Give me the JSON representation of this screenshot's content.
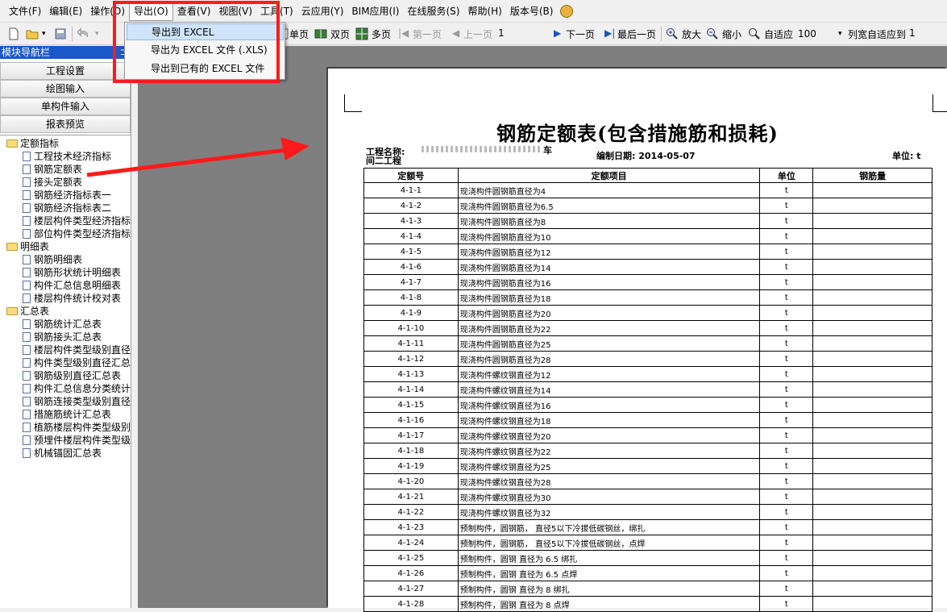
{
  "menu": {
    "items": [
      "文件(F)",
      "编辑(E)",
      "操作(O)",
      "导出(O)",
      "查看(V)",
      "视图(V)",
      "工具(T)",
      "云应用(Y)",
      "BIM应用(I)",
      "在线服务(S)",
      "帮助(H)",
      "版本号(B)"
    ],
    "active_index": 3
  },
  "export_menu": {
    "items": [
      "导出到 EXCEL",
      "导出为 EXCEL 文件 (.XLS)",
      "导出到已有的 EXCEL 文件"
    ]
  },
  "toolbar": {
    "single_page": "单页",
    "double_page": "双页",
    "multi_page": "多页",
    "first_page": "第一页",
    "prev_page": "上一页",
    "page_number": "1",
    "next_page": "下一页",
    "last_page": "最后一页",
    "zoom_in": "放大",
    "zoom_out": "缩小",
    "fit": "自适应",
    "zoom_value": "100",
    "column_fit": "列宽自适应到",
    "column_fit_value": "1"
  },
  "left_panel": {
    "title": "模块导航栏",
    "nav_buttons": [
      "工程设置",
      "绘图输入",
      "单构件输入",
      "报表预览"
    ],
    "tree": [
      {
        "type": "folder",
        "label": "定额指标"
      },
      {
        "type": "doc",
        "label": "工程技术经济指标"
      },
      {
        "type": "doc",
        "label": "钢筋定额表"
      },
      {
        "type": "doc",
        "label": "接头定额表"
      },
      {
        "type": "doc",
        "label": "钢筋经济指标表一"
      },
      {
        "type": "doc",
        "label": "钢筋经济指标表二"
      },
      {
        "type": "doc",
        "label": "楼层构件类型经济指标"
      },
      {
        "type": "doc",
        "label": "部位构件类型经济指标"
      },
      {
        "type": "folder",
        "label": "明细表"
      },
      {
        "type": "doc",
        "label": "钢筋明细表"
      },
      {
        "type": "doc",
        "label": "钢筋形状统计明细表"
      },
      {
        "type": "doc",
        "label": "构件汇总信息明细表"
      },
      {
        "type": "doc",
        "label": "楼层构件统计校对表"
      },
      {
        "type": "folder",
        "label": "汇总表"
      },
      {
        "type": "doc",
        "label": "钢筋统计汇总表"
      },
      {
        "type": "doc",
        "label": "钢筋接头汇总表"
      },
      {
        "type": "doc",
        "label": "楼层构件类型级别直径"
      },
      {
        "type": "doc",
        "label": "构件类型级别直径汇总"
      },
      {
        "type": "doc",
        "label": "钢筋级别直径汇总表"
      },
      {
        "type": "doc",
        "label": "构件汇总信息分类统计"
      },
      {
        "type": "doc",
        "label": "钢筋连接类型级别直径"
      },
      {
        "type": "doc",
        "label": "措施筋统计汇总表"
      },
      {
        "type": "doc",
        "label": "植筋楼层构件类型级别"
      },
      {
        "type": "doc",
        "label": "预埋件楼层构件类型级"
      },
      {
        "type": "doc",
        "label": "机械锚固汇总表"
      }
    ]
  },
  "report": {
    "title": "钢筋定额表(包含措施筋和损耗)",
    "project_label": "工程名称:",
    "project_suffix": "车",
    "project_line2": "间二工程",
    "date_label": "编制日期: 2014-05-07",
    "unit_label": "单位: t",
    "columns": [
      "定额号",
      "定额项目",
      "单位",
      "钢筋量"
    ],
    "rows": [
      [
        "4-1-1",
        "现浇构件圆钢筋直径为4",
        "t",
        ""
      ],
      [
        "4-1-2",
        "现浇构件圆钢筋直径为6.5",
        "t",
        ""
      ],
      [
        "4-1-3",
        "现浇构件圆钢筋直径为8",
        "t",
        ""
      ],
      [
        "4-1-4",
        "现浇构件圆钢筋直径为10",
        "t",
        ""
      ],
      [
        "4-1-5",
        "现浇构件圆钢筋直径为12",
        "t",
        ""
      ],
      [
        "4-1-6",
        "现浇构件圆钢筋直径为14",
        "t",
        ""
      ],
      [
        "4-1-7",
        "现浇构件圆钢筋直径为16",
        "t",
        ""
      ],
      [
        "4-1-8",
        "现浇构件圆钢筋直径为18",
        "t",
        ""
      ],
      [
        "4-1-9",
        "现浇构件圆钢筋直径为20",
        "t",
        ""
      ],
      [
        "4-1-10",
        "现浇构件圆钢筋直径为22",
        "t",
        ""
      ],
      [
        "4-1-11",
        "现浇构件圆钢筋直径为25",
        "t",
        ""
      ],
      [
        "4-1-12",
        "现浇构件圆钢筋直径为28",
        "t",
        ""
      ],
      [
        "4-1-13",
        "现浇构件螺纹钢直径为12",
        "t",
        ""
      ],
      [
        "4-1-14",
        "现浇构件螺纹钢直径为14",
        "t",
        ""
      ],
      [
        "4-1-15",
        "现浇构件螺纹钢直径为16",
        "t",
        ""
      ],
      [
        "4-1-16",
        "现浇构件螺纹钢直径为18",
        "t",
        ""
      ],
      [
        "4-1-17",
        "现浇构件螺纹钢直径为20",
        "t",
        ""
      ],
      [
        "4-1-18",
        "现浇构件螺纹钢直径为22",
        "t",
        ""
      ],
      [
        "4-1-19",
        "现浇构件螺纹钢直径为25",
        "t",
        ""
      ],
      [
        "4-1-20",
        "现浇构件螺纹钢直径为28",
        "t",
        ""
      ],
      [
        "4-1-21",
        "现浇构件螺纹钢直径为30",
        "t",
        ""
      ],
      [
        "4-1-22",
        "现浇构件螺纹钢直径为32",
        "t",
        ""
      ],
      [
        "4-1-23",
        "预制构件，圆钢筋， 直径5以下冷拔低碳钢丝，绑扎",
        "t",
        ""
      ],
      [
        "4-1-24",
        "预制构件，圆钢筋， 直径5以下冷拔低碳钢丝，点焊",
        "t",
        ""
      ],
      [
        "4-1-25",
        "预制构件，圆钢 直径为 6.5 绑扎",
        "t",
        ""
      ],
      [
        "4-1-26",
        "预制构件，圆钢 直径为 6.5 点焊",
        "t",
        ""
      ],
      [
        "4-1-27",
        "预制构件，圆钢 直径为 8 绑扎",
        "t",
        ""
      ],
      [
        "4-1-28",
        "预制构件，圆钢 直径为 8 点焊",
        "t",
        ""
      ]
    ]
  },
  "colors": {
    "annotation_red": "#ff1a1a",
    "panel_title_blue": "#1a57c9",
    "menu_highlight": "#cfe3fa",
    "workspace_grey": "#7f7f7f"
  }
}
